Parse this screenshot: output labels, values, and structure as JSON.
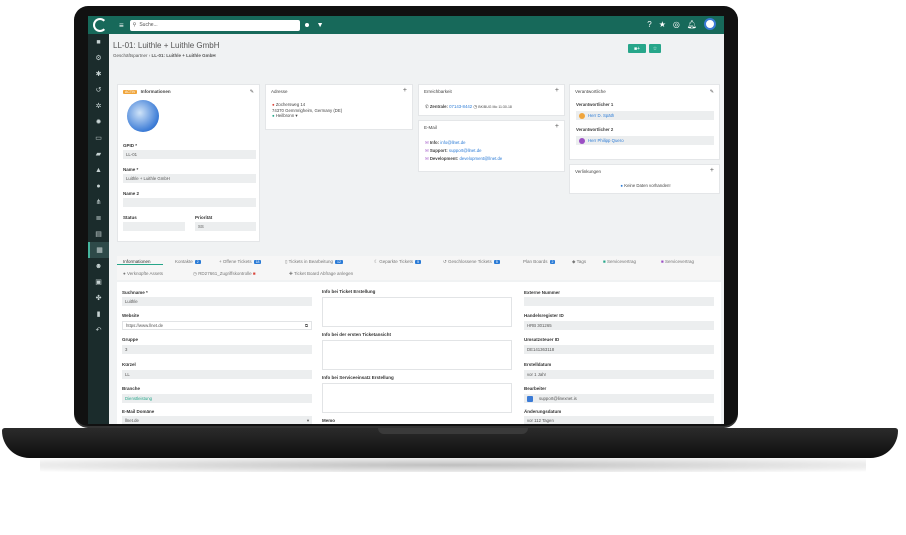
{
  "search": {
    "placeholder": "Suche..."
  },
  "page": {
    "title": "LL-01: Luithle + Luithle GmbH",
    "breadcrumb_root": "Geschäftspartner",
    "breadcrumb_current": "LL-01: Luithle + Luithle GmbH"
  },
  "info_card": {
    "badge": "ACTIV",
    "title": "Informationen",
    "gpid_label": "GPID *",
    "gpid_value": "LL-01",
    "name_label": "Name *",
    "name_value": "Luithle + Luithle GmbH",
    "name2_label": "Name 2",
    "status_label": "Status",
    "priority_label": "Priorität",
    "priority_value": "SS"
  },
  "address_card": {
    "title": "Adresse",
    "street": "Zochersweg 14",
    "city": "74370 Gemmrigheim, Germany (DE)",
    "region": "Heilbronn"
  },
  "reach_card": {
    "title": "Erreichbarkeit",
    "zentrale_label": "Zentrale:",
    "zentrale_value": "07143-8442",
    "extra": "BK/BUG Mo 11:30-18"
  },
  "email_card": {
    "title": "E-Mail",
    "rows": [
      {
        "label": "Info:",
        "value": "info@llnet.de"
      },
      {
        "label": "Support:",
        "value": "support@llnet.de"
      },
      {
        "label": "Development:",
        "value": "development@llnet.de"
      }
    ]
  },
  "resp_card": {
    "title": "Verantwortliche",
    "r1_label": "Verantwortlicher 1",
    "r1_name": "Herr D. Späth",
    "r2_label": "Verantwortlicher 2",
    "r2_name": "Herr Philipp Quero"
  },
  "links_card": {
    "title": "Verlinkungen",
    "empty": "Keine Daten vorhanden!"
  },
  "tabs": [
    {
      "label": "Informationen"
    },
    {
      "label": "Kontakte",
      "badge": "2"
    },
    {
      "label": "Offene Tickets",
      "badge": "18"
    },
    {
      "label": "Tickets in Bearbeitung",
      "badge": "12"
    },
    {
      "label": "Geparkte Tickets",
      "badge": "5"
    },
    {
      "label": "Geschlossene Tickets",
      "badge": "5"
    },
    {
      "label": "Plan Boards",
      "badge": "2"
    },
    {
      "label": "Tags"
    },
    {
      "label": "Servicevertrag"
    },
    {
      "label": "Servicevertrag"
    }
  ],
  "tabs2": [
    {
      "label": "Verknüpfte Assets"
    },
    {
      "label": "RD27661_Zugriffskontrolle"
    },
    {
      "label": "Ticket Board Abfrage anlegen"
    }
  ],
  "form": {
    "col1": [
      {
        "label": "Suchname *",
        "value": "Luithle"
      },
      {
        "label": "Website",
        "value": "https://www.llnet.de"
      },
      {
        "label": "Gruppe",
        "value": "3"
      },
      {
        "label": "Kürzel",
        "value": "LL"
      },
      {
        "label": "Branche",
        "value": "Dienstleistung"
      },
      {
        "label": "E-Mail Domäne",
        "value": "llnet.de"
      }
    ],
    "col2": [
      {
        "label": "Info bei Ticket Erstellung"
      },
      {
        "label": "Info bei der ersten Ticketansicht"
      },
      {
        "label": "Info bei Serviceeinsatz Erstellung"
      },
      {
        "label": "Memo"
      }
    ],
    "col3": [
      {
        "label": "Externe Nummer",
        "value": ""
      },
      {
        "label": "Handelsregister ID",
        "value": "HRB 301265"
      },
      {
        "label": "Umsatzsteuer ID",
        "value": "DE141363118"
      },
      {
        "label": "Erstelldatum",
        "value": "vor 1 Jahr"
      },
      {
        "label": "Bearbeiter",
        "value": "support@linexnet.is"
      },
      {
        "label": "Änderungsdatum",
        "value": "vor 112 Tagen"
      }
    ]
  }
}
